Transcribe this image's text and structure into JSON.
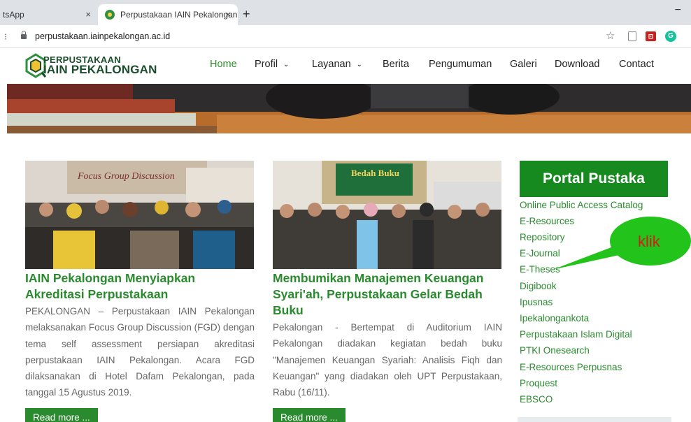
{
  "browser": {
    "tabs": [
      {
        "label": "tsApp"
      },
      {
        "label": "Perpustakaan IAIN Pekalongan"
      }
    ],
    "url": "perpustakaan.iainpekalongan.ac.id",
    "new_tab": "+",
    "close_glyph": "×",
    "minimize_glyph": "−",
    "star_glyph": "☆",
    "ext_icons": [
      "page-icon",
      "pdf-icon",
      "grammarly-icon"
    ]
  },
  "site": {
    "logo": {
      "line1": "PERPUSTAKAAN",
      "line2": "IAIN PEKALONGAN"
    },
    "nav": [
      {
        "label": "Home",
        "active": true
      },
      {
        "label": "Profil",
        "caret": true
      },
      {
        "label": "Layanan",
        "caret": true
      },
      {
        "label": "Berita"
      },
      {
        "label": "Pengumuman"
      },
      {
        "label": "Galeri"
      },
      {
        "label": "Download"
      },
      {
        "label": "Contact"
      }
    ],
    "caret_glyph": "⌄",
    "colors": {
      "brand_green": "#2a8a2e",
      "portal_green": "#16891f",
      "callout_green": "#22c31a",
      "callout_text": "#d11d1d"
    }
  },
  "posts": [
    {
      "image_text": "Focus Group Discussion",
      "title_lines": [
        "IAIN Pekalongan Menyiapkan",
        "Akreditasi Perpustakaan"
      ],
      "body": "PEKALONGAN – Perpustakaan IAIN Pekalongan melaksanakan Focus Group Discussion (FGD) dengan tema self assessment persiapan akreditasi perpustakaan IAIN Pekalongan. Acara FGD dilaksanakan di Hotel Dafam Pekalongan, pada tanggal 15 Agustus 2019.",
      "read_more": "Read more ..."
    },
    {
      "image_text": "Bedah Buku",
      "title_lines": [
        "Membumikan Manajemen Keuangan",
        "Syari'ah, Perpustakaan Gelar Bedah",
        "Buku"
      ],
      "body": "Pekalongan - Bertempat di Auditorium IAIN Pekalongan diadakan kegiatan bedah buku \"Manajemen Keuangan Syariah: Analisis Fiqh dan Keuangan\" yang diadakan oleh UPT Perpustakaan, Rabu (16/11).",
      "read_more": "Read more ..."
    }
  ],
  "sidebar": {
    "heading": "Portal Pustaka",
    "links": [
      "Online Public Access Catalog",
      "E-Resources",
      "Repository",
      "E-Journal",
      "E-Theses",
      "Digibook",
      "Ipusnas",
      "Ipekalongankota",
      "Perpustakaan Islam Digital",
      "PTKI Onesearch",
      "E-Resources Perpusnas",
      "Proquest",
      "EBSCO"
    ]
  },
  "callout": {
    "text": "klik"
  }
}
